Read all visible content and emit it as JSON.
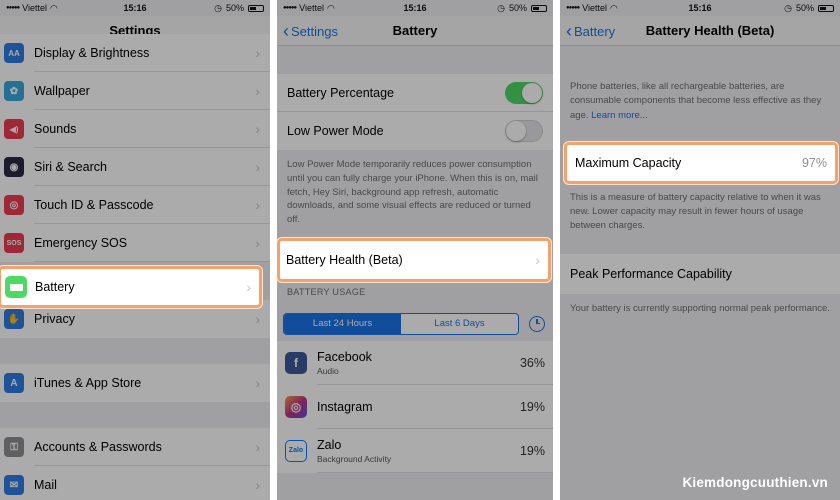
{
  "status": {
    "carrier": "Viettel",
    "time": "15:16",
    "battery": "50%"
  },
  "panel1": {
    "title": "Settings",
    "items": [
      {
        "label": "Display & Brightness",
        "icon": "text-size-icon",
        "color": "#2f7de1",
        "glyph": "AA"
      },
      {
        "label": "Wallpaper",
        "icon": "flower-icon",
        "color": "#36aadc",
        "glyph": "✿"
      },
      {
        "label": "Sounds",
        "icon": "speaker-icon",
        "color": "#ef3b4f",
        "glyph": "◀)"
      },
      {
        "label": "Siri & Search",
        "icon": "siri-icon",
        "color": "#2b2b44",
        "glyph": "◉"
      },
      {
        "label": "Touch ID & Passcode",
        "icon": "fingerprint-icon",
        "color": "#ef3b4f",
        "glyph": "◎"
      },
      {
        "label": "Emergency SOS",
        "icon": "sos-icon",
        "color": "#ef3b4f",
        "glyph": "SOS"
      },
      {
        "label": "Battery",
        "icon": "battery-icon",
        "color": "#4cd964",
        "glyph": ""
      },
      {
        "label": "Privacy",
        "icon": "hand-icon",
        "color": "#2f7de1",
        "glyph": "✋"
      },
      {
        "label": "iTunes & App Store",
        "icon": "app-store-icon",
        "color": "#2f7de1",
        "glyph": "A"
      },
      {
        "label": "Accounts & Passwords",
        "icon": "key-icon",
        "color": "#8e8e93",
        "glyph": "⚿"
      },
      {
        "label": "Mail",
        "icon": "mail-icon",
        "color": "#2f7de1",
        "glyph": "✉"
      }
    ]
  },
  "panel2": {
    "back": "Settings",
    "title": "Battery",
    "battery_percentage": "Battery Percentage",
    "low_power_mode": "Low Power Mode",
    "low_power_note": "Low Power Mode temporarily reduces power consumption until you can fully charge your iPhone. When this is on, mail fetch, Hey Siri, background app refresh, automatic downloads, and some visual effects are reduced or turned off.",
    "battery_health": "Battery Health (Beta)",
    "usage_header": "BATTERY USAGE",
    "seg_left": "Last 24 Hours",
    "seg_right": "Last 6 Days",
    "apps": [
      {
        "name": "Facebook",
        "sub": "Audio",
        "pct": "36%",
        "icon": "facebook-icon",
        "color": "#3b5998",
        "glyph": "f"
      },
      {
        "name": "Instagram",
        "sub": "",
        "pct": "19%",
        "icon": "instagram-icon",
        "color": "#c13584",
        "glyph": "◎"
      },
      {
        "name": "Zalo",
        "sub": "Background Activity",
        "pct": "19%",
        "icon": "zalo-icon",
        "color": "#0a7cff",
        "glyph": "Zalo"
      }
    ]
  },
  "panel3": {
    "back": "Battery",
    "title": "Battery Health (Beta)",
    "intro": "Phone batteries, like all rechargeable batteries, are consumable components that become less effective as they age.",
    "learn_more": "Learn more...",
    "max_capacity_label": "Maximum Capacity",
    "max_capacity_value": "97%",
    "capacity_note": "This is a measure of battery capacity relative to when it was new. Lower capacity may result in fewer hours of usage between charges.",
    "peak_label": "Peak Performance Capability",
    "peak_note": "Your battery is currently supporting normal peak performance."
  },
  "watermark": "Kiemdongcuuthien.vn"
}
